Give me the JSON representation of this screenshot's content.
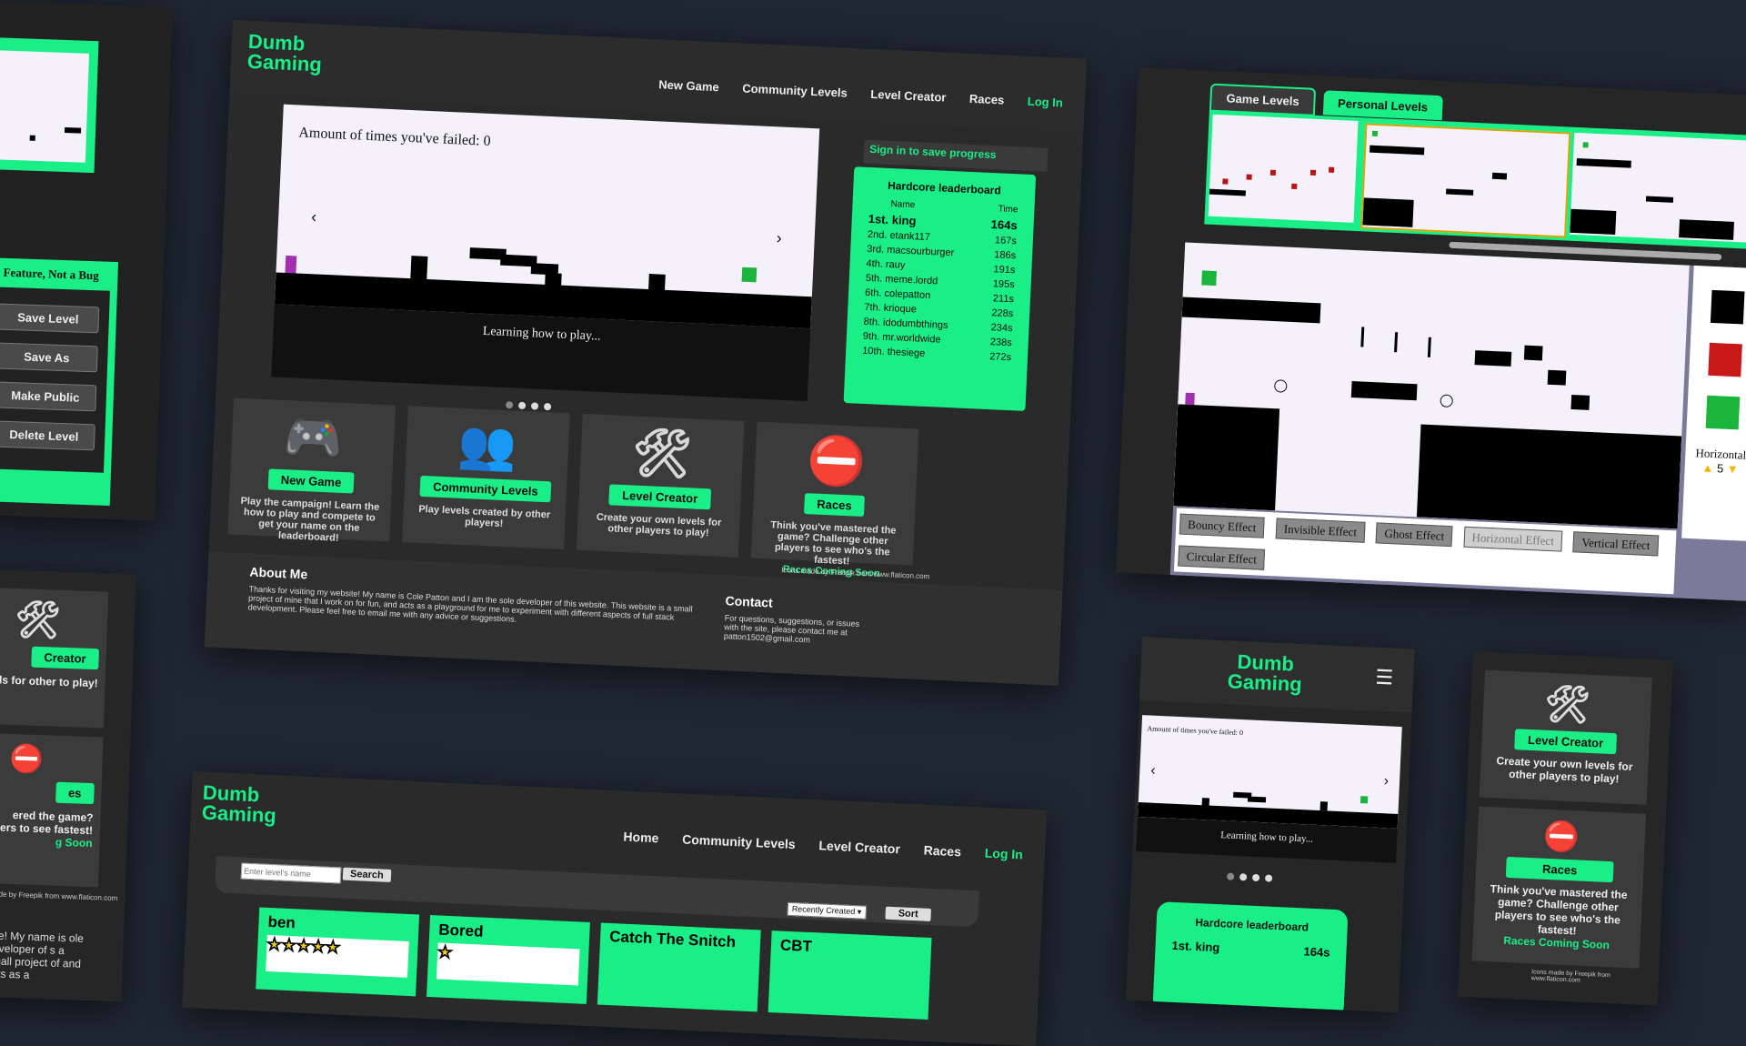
{
  "brand": {
    "line1": "Dumb",
    "line2": "Gaming"
  },
  "nav_main": [
    "New Game",
    "Community Levels",
    "Level Creator",
    "Races",
    "Log In"
  ],
  "nav_browse": [
    "Home",
    "Community Levels",
    "Level Creator",
    "Races",
    "Log In"
  ],
  "game": {
    "fail_text": "Amount of times you've failed: 0",
    "caption": "Learning how to play...",
    "prev": "‹",
    "next": "›"
  },
  "sign_in": "Sign in to save progress",
  "leaderboard": {
    "title": "Hardcore leaderboard",
    "col_name": "Name",
    "col_time": "Time",
    "rows": [
      {
        "name": "1st. king",
        "time": "164s"
      },
      {
        "name": "2nd. etank117",
        "time": "167s"
      },
      {
        "name": "3rd. macsourburger",
        "time": "186s"
      },
      {
        "name": "4th. rauy",
        "time": "191s"
      },
      {
        "name": "5th. meme.lordd",
        "time": "195s"
      },
      {
        "name": "6th. colepatton",
        "time": "211s"
      },
      {
        "name": "7th. krioque",
        "time": "228s"
      },
      {
        "name": "8th. idodumbthings",
        "time": "234s"
      },
      {
        "name": "9th. mr.worldwide",
        "time": "238s"
      },
      {
        "name": "10th. thesiege",
        "time": "272s"
      }
    ]
  },
  "cards": [
    {
      "icon": "🎮",
      "button": "New Game",
      "desc": "Play the campaign! Learn the how to play and compete to get your name on the leaderboard!"
    },
    {
      "icon": "👥",
      "button": "Community Levels",
      "desc": "Play levels created by other players!"
    },
    {
      "icon": "🛠",
      "button": "Level Creator",
      "desc": "Create your own levels for other players to play!"
    },
    {
      "icon": "⛔",
      "button": "Races",
      "desc": "Think you've mastered the game? Challenge other players to see who's the fastest!",
      "note": "Races Coming Soon"
    }
  ],
  "credit": "Icons made by Freepik from www.flaticon.com",
  "about": {
    "title": "About Me",
    "text": "Thanks for visiting my website! My name is Cole Patton and I am the sole developer of this website. This website is a small project of mine that I work on for fun, and acts as a playground for me to experiment with different aspects of full stack development. Please feel free to email me with any advice or suggestions."
  },
  "contact": {
    "title": "Contact",
    "text": "For questions, suggestions, or issues with the site, please contact me at patton1502@gmail.com"
  },
  "editor": {
    "title": "s a Feature, Not a Bug",
    "buttons": [
      "Save Level",
      "Save As",
      "Make Public",
      "Delete Level"
    ]
  },
  "creator": {
    "tabs": [
      "Game Levels",
      "Personal Levels"
    ],
    "effects": [
      "Bouncy Effect",
      "Invisible Effect",
      "Ghost Effect",
      "Horizontal Effect",
      "Vertical Effect",
      "Circular Effect"
    ],
    "side_label": "Horizontal",
    "side_value": "5"
  },
  "browse": {
    "search_placeholder": "Enter level's name",
    "search_btn": "Search",
    "sort_value": "Recently Created",
    "sort_btn": "Sort",
    "levels": [
      "ben",
      "Bored",
      "Catch The Snitch",
      "CBT"
    ]
  },
  "left_col": {
    "creator_btn": "Creator",
    "creator_desc": "levels for other to play!",
    "races_btn": "es",
    "races_desc": "ered the game? players to see fastest!",
    "races_note": "g Soon",
    "credit": "made by Freepik from www.flaticon.com",
    "about_frag": "site! My name is ole developer of s a small project of and acts as a"
  },
  "mobile": {
    "fail_text": "Amount of times you've failed: 0",
    "caption": "Learning how to play...",
    "lb_title": "Hardcore leaderboard",
    "lb_first_name": "1st. king",
    "lb_first_time": "164s"
  },
  "mobile_cards": {
    "creator_btn": "Level Creator",
    "creator_desc": "Create your own levels for other players to play!",
    "races_btn": "Races",
    "races_desc": "Think you've mastered the game? Challenge other players to see who's the fastest!",
    "races_note": "Races Coming Soon",
    "credit": "Icons made by Freepik from www.flaticon.com"
  }
}
